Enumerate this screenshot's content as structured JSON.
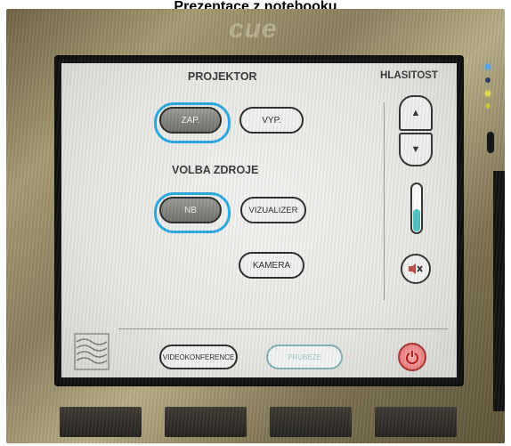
{
  "caption": "Prezentace z notebooku",
  "device": {
    "brand": "cue"
  },
  "panel": {
    "projector_label": "PROJEKTOR",
    "projector_on": "ZAP.",
    "projector_off": "VYP.",
    "source_label": "VOLBA ZDROJE",
    "source_nb": "NB",
    "source_visualizer": "VIZUALIZER",
    "source_camera": "KAMERA",
    "volume_label": "HLASITOST",
    "volume_level": 0.5,
    "videoconference": "VIDEOKONFERENCE",
    "dimmed_button": "PRUBEZE",
    "icons": {
      "volume_up": "triangle-up-icon",
      "volume_down": "triangle-down-icon",
      "mute": "speaker-mute-icon",
      "power": "power-icon",
      "logo": "wave-logo-icon"
    },
    "colors": {
      "selected_ring": "#29a9e2",
      "volume_fill": "#4fc4c0",
      "power": "#e36a6a"
    }
  }
}
